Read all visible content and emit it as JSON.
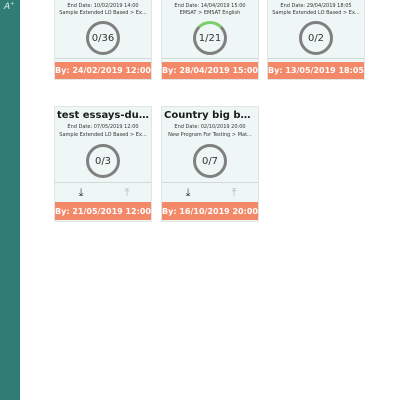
{
  "colors": {
    "sidebar": "#2f7d74",
    "card_background": "#eef7f5",
    "footer_background": "#f4896a",
    "progress_ring": "#808080",
    "progress_fill": "#7ccf6a"
  },
  "sidebar": {
    "icon": "teacher-icon"
  },
  "cards": [
    {
      "end_date": "End Date: 10/02/2019 14:00",
      "path": "Sample Extended LO Based > Ex...",
      "progress": "0/36",
      "due": "By: 24/02/2019 12:00"
    },
    {
      "end_date": "End Date: 14/04/2019 15:00",
      "path": "EMSAT > EMSAT English",
      "progress": "1/21",
      "due": "By: 28/04/2019 15:00"
    },
    {
      "end_date": "End Date: 29/04/2019 18:05",
      "path": "Sample Extended LO Based > Ex...",
      "progress": "0/2",
      "due": "By: 13/05/2019 18:05"
    },
    {
      "title": "test essays-duplic...",
      "end_date": "End Date: 07/05/2019 12:00",
      "path": "Sample Extended LO Based > Ex...",
      "progress": "0/3",
      "due": "By: 21/05/2019 12:00"
    },
    {
      "title": "Country big boys",
      "end_date": "End Date: 02/10/2019 20:00",
      "path": "New Program For Testing > Mat...",
      "progress": "0/7",
      "due": "By: 16/10/2019 20:00"
    }
  ],
  "icons": {
    "download": "download-icon",
    "upload": "upload-icon"
  }
}
